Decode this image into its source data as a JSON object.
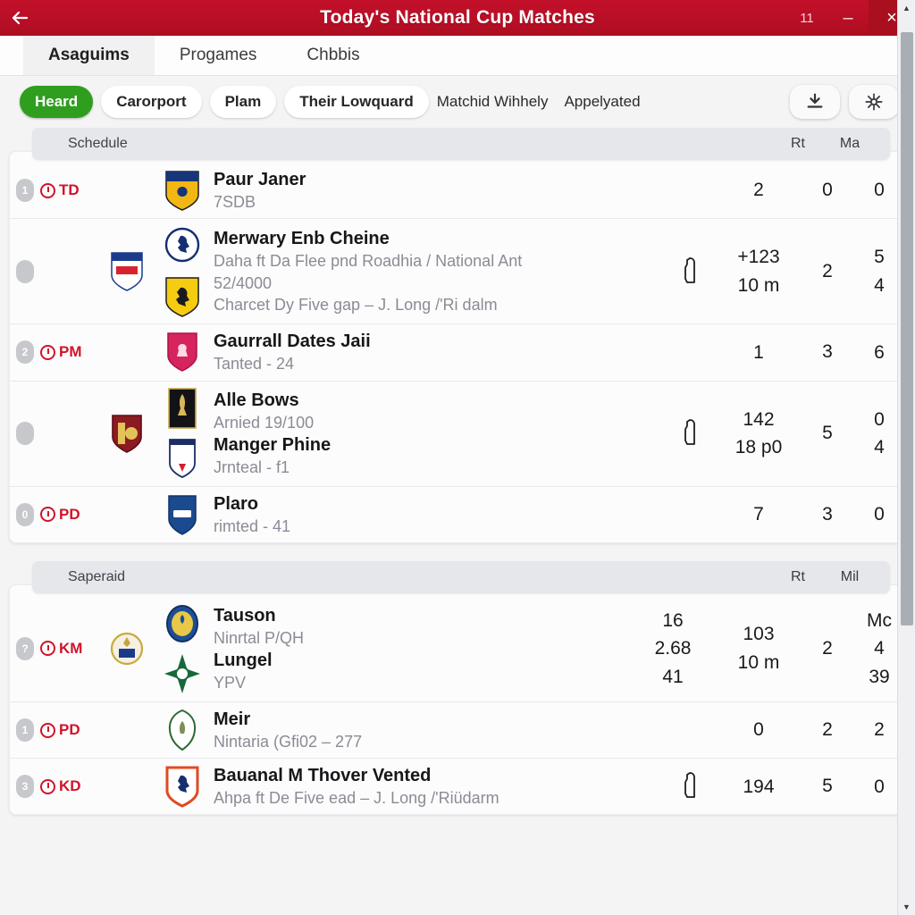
{
  "window": {
    "title": "Today's National Cup Matches",
    "back_icon": "back-arrow-icon",
    "restore_label": "11",
    "minimize_label": "–",
    "close_label": "×"
  },
  "tabs": [
    {
      "label": "Asaguims",
      "active": true
    },
    {
      "label": "Progames",
      "active": false
    },
    {
      "label": "Chbbis",
      "active": false
    }
  ],
  "filters": {
    "chips": [
      {
        "label": "Heard",
        "selected": true
      },
      {
        "label": "Carorport",
        "selected": false
      },
      {
        "label": "Plam",
        "selected": false
      },
      {
        "label": "Their Lowquard",
        "selected": false
      }
    ],
    "plain": [
      "Matchid Wihhely",
      "Appelyated"
    ],
    "actions": [
      {
        "name": "download-icon"
      },
      {
        "name": "settings-gear-icon"
      }
    ]
  },
  "sections": [
    {
      "title": "Schedule",
      "columns": [
        "Rt",
        "Ma"
      ],
      "rows": [
        {
          "status": "1",
          "time": "TD",
          "team": "Paur Janer",
          "sub": "7SDB",
          "n1": "2",
          "n2": "0",
          "n3": "0"
        },
        {
          "status": "",
          "time": "",
          "team": "Merwary Enb Cheine",
          "sub": "Daha ft Da Flee pnd Roadhia / National Ant",
          "sub2": "52/4000",
          "sub3": "Charcet Dy Five gap – J. Long /'Ri dalm",
          "n1": "+123",
          "n1b": "10 m",
          "n2": "2",
          "n3": "5",
          "n3b": "4",
          "has_bottle": true
        },
        {
          "status": "2",
          "time": "PM",
          "team": "Gaurrall Dates Jaii",
          "sub": "Tanted - 24",
          "n1": "1",
          "n2": "3",
          "n3": "6"
        },
        {
          "status": "",
          "time": "",
          "team": "Alle Bows",
          "sub": "Arnied 19/100",
          "team2": "Manger Phine",
          "sub2": "Jrnteal - f1",
          "n1": "142",
          "n1b": "18 p0",
          "n2": "5",
          "n3": "0",
          "n3b": "4",
          "has_bottle": true
        },
        {
          "status": "0",
          "time": "PD",
          "team": "Plaro",
          "sub": "rimted - 41",
          "n1": "7",
          "n2": "3",
          "n3": "0"
        }
      ]
    },
    {
      "title": "Saperaid",
      "columns": [
        "Rt",
        "Mil"
      ],
      "rows": [
        {
          "status": "?",
          "time": "KM",
          "team": "Tauson",
          "sub": "Ninrtal P/QH",
          "team2": "Lungel",
          "sub2": "YPV",
          "n1": "16",
          "n1b": "2.68",
          "n1c": "41",
          "n2": "103",
          "n2b": "10 m",
          "n3": "2",
          "n4": "Mc",
          "n4b": "4",
          "n4c": "39"
        },
        {
          "status": "1",
          "time": "PD",
          "team": "Meir",
          "sub": "Nintaria (Gfi02 – 277",
          "n1": "0",
          "n2": "2",
          "n3": "2"
        },
        {
          "status": "3",
          "time": "KD",
          "team": "Bauanal M Thover Vented",
          "sub": "Ahpa ft De Five ead – J. Long /'Riüdarm",
          "n1": "194",
          "n2": "5",
          "n3": "0",
          "has_bottle": true
        }
      ]
    }
  ],
  "colors": {
    "brand_red": "#b80f26",
    "accent_green": "#2f9e1f",
    "time_red": "#d0142a"
  }
}
